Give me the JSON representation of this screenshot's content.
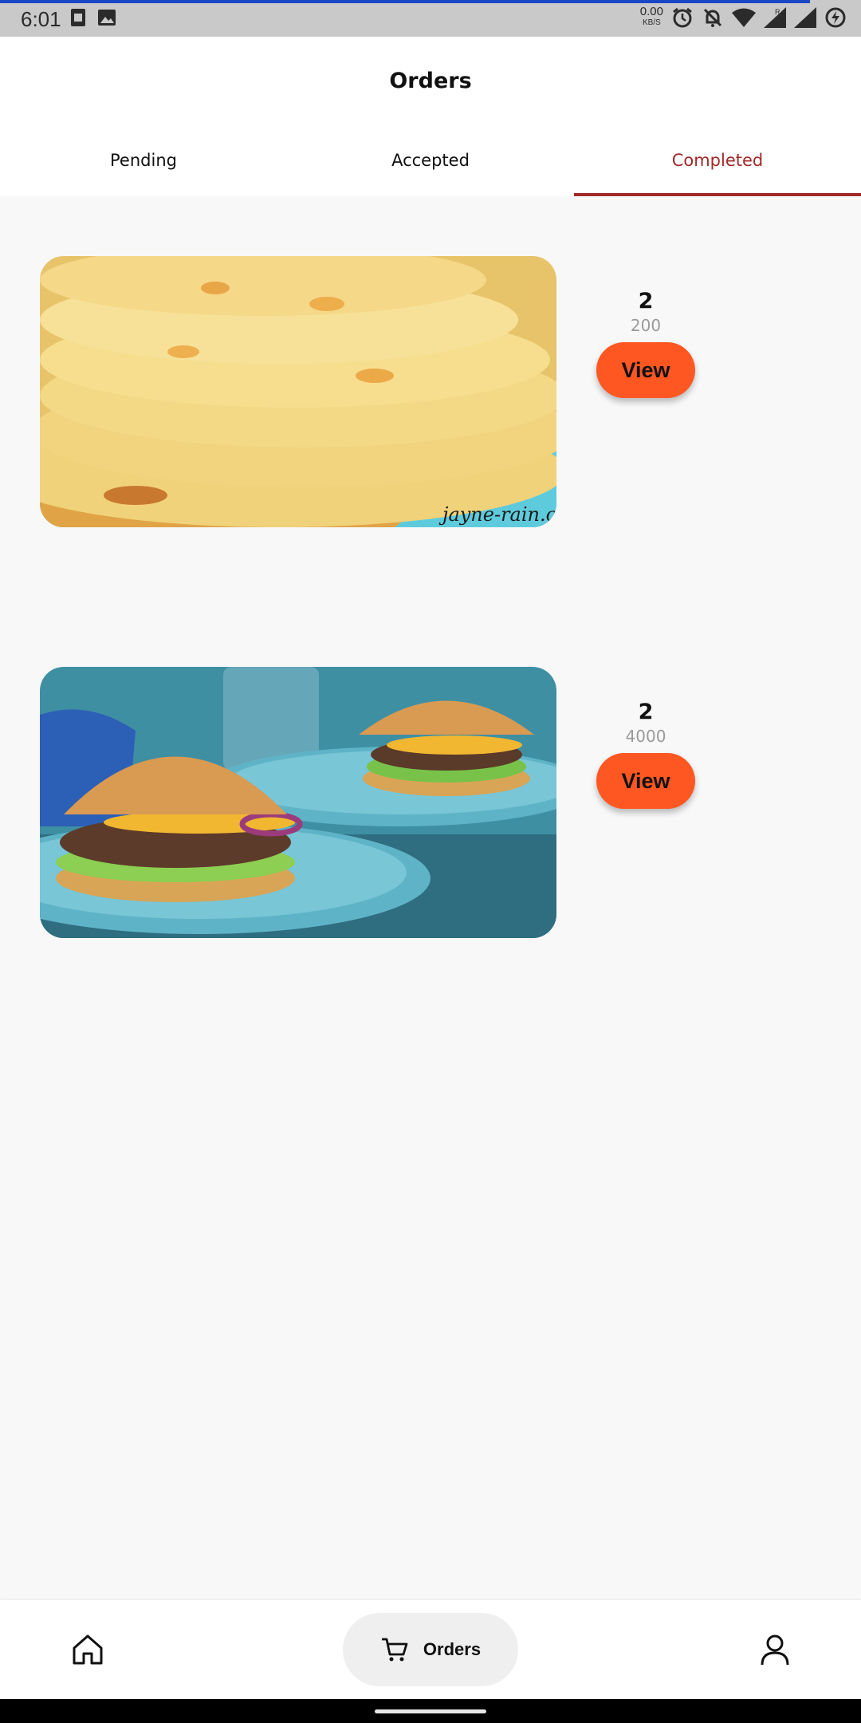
{
  "status_bar": {
    "time": "6:01",
    "net_speed_value": "0.00",
    "net_speed_unit": "KB/S",
    "icons": [
      "sim-icon",
      "image-icon",
      "alarm-icon",
      "notifications-off-icon",
      "wifi-icon",
      "signal-icon",
      "signal-roaming-icon",
      "battery-charging-icon"
    ],
    "accent_color": "#1b46c4"
  },
  "header": {
    "title": "Orders"
  },
  "tabs": [
    {
      "label": "Pending",
      "active": false
    },
    {
      "label": "Accepted",
      "active": false
    },
    {
      "label": "Completed",
      "active": true
    }
  ],
  "orders": [
    {
      "image": "flatbread-photo",
      "quantity": "2",
      "price": "200",
      "action_label": "View"
    },
    {
      "image": "burger-photo",
      "quantity": "2",
      "price": "4000",
      "action_label": "View"
    }
  ],
  "image_text": {
    "watermark": "jayne-rain.c"
  },
  "bottom_nav": {
    "home_icon": "home-icon",
    "orders_icon": "cart-icon",
    "orders_label": "Orders",
    "profile_icon": "user-icon"
  },
  "colors": {
    "active_tab": "#a3292a",
    "view_button": "#ff5722",
    "price_text": "#9a9a9a"
  }
}
